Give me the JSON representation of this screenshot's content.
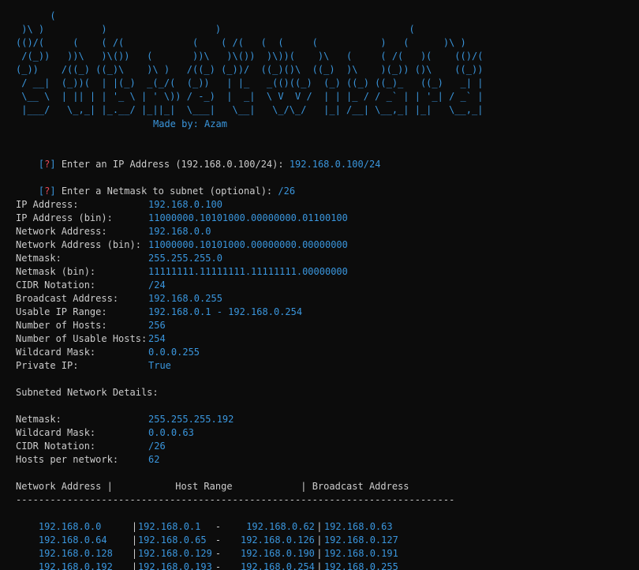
{
  "banner": {
    "ascii": "      (                                                                      \n )\\ )          )                   )                                 (       \n(()/(     (    ( /(            (    ( /(   (  (     (           )   (      )\\ )    \n /(_))   ))\\   )\\())   (       ))\\   )\\())  )\\))(    )\\   (     ( /(   )(    (()/(   \n(_))    /((_) ((_)\\    )\\ )   /((_) (_))/  ((_)()\\  ((_)  )\\    )(_)) ()\\    ((_))  \n / __|  (_))(  | |(_)  _(_/(  (_))   | |_   _(()((_)  (_) ((_) ((_)_   ((_)   _| |  \n \\__ \\  | || | | '_ \\ | ' \\)) / -_)  |  _|  \\ V  V /  | | |_ / / _` | | '_| / _` |  \n |___/   \\_,_| |_.__/ |_||_|  \\___|   \\__|   \\_/\\_/   |_| /__| \\__,_| |_|   \\__,_|  ",
    "author": "Made by: Azam"
  },
  "prompts": [
    {
      "mark_open": "[",
      "mark_q": "?",
      "mark_close": "]",
      "text": " Enter an IP Address (192.168.0.100/24): ",
      "value": "192.168.0.100/24"
    },
    {
      "mark_open": "[",
      "mark_q": "?",
      "mark_close": "]",
      "text": " Enter a Netmask to subnet (optional): ",
      "value": "/26"
    }
  ],
  "details": [
    {
      "label": "IP Address:",
      "value": "192.168.0.100"
    },
    {
      "label": "IP Address (bin):",
      "value": "11000000.10101000.00000000.01100100"
    },
    {
      "label": "Network Address:",
      "value": "192.168.0.0"
    },
    {
      "label": "Network Address (bin):",
      "value": "11000000.10101000.00000000.00000000"
    },
    {
      "label": "Netmask:",
      "value": "255.255.255.0"
    },
    {
      "label": "Netmask (bin):",
      "value": "11111111.11111111.11111111.00000000"
    },
    {
      "label": "CIDR Notation:",
      "value": "/24"
    },
    {
      "label": "Broadcast Address:",
      "value": "192.168.0.255"
    },
    {
      "label": "Usable IP Range:",
      "value": "192.168.0.1 - 192.168.0.254"
    },
    {
      "label": "Number of Hosts:",
      "value": "256"
    },
    {
      "label": "Number of Usable Hosts:",
      "value": "254"
    },
    {
      "label": "Wildcard Mask:",
      "value": "0.0.0.255"
    },
    {
      "label": "Private IP:",
      "value": "True"
    }
  ],
  "subnet_heading": "Subneted Network Details:",
  "subnet_details": [
    {
      "label": "Netmask:",
      "value": "255.255.255.192"
    },
    {
      "label": "Wildcard Mask:",
      "value": "0.0.0.63"
    },
    {
      "label": "CIDR Notation:",
      "value": "/26"
    },
    {
      "label": "Hosts per network:",
      "value": "62"
    }
  ],
  "table": {
    "header": {
      "network": "Network Address ",
      "sep1": "|",
      "host": "           Host Range            ",
      "sep2": "|",
      "broadcast": " Broadcast Address"
    },
    "rule": "-----------------------------------------------------------------------------",
    "rows": [
      {
        "network": "192.168.0.0",
        "host_start": "192.168.0.1",
        "dash": "-",
        "host_end": "192.168.0.62",
        "broadcast": "192.168.0.63"
      },
      {
        "network": "192.168.0.64",
        "host_start": "192.168.0.65",
        "dash": "-",
        "host_end": "192.168.0.126",
        "broadcast": "192.168.0.127"
      },
      {
        "network": "192.168.0.128",
        "host_start": "192.168.0.129",
        "dash": "-",
        "host_end": "192.168.0.190",
        "broadcast": "192.168.0.191"
      },
      {
        "network": "192.168.0.192",
        "host_start": "192.168.0.193",
        "dash": "-",
        "host_end": "192.168.0.254",
        "broadcast": "192.168.0.255"
      }
    ]
  }
}
